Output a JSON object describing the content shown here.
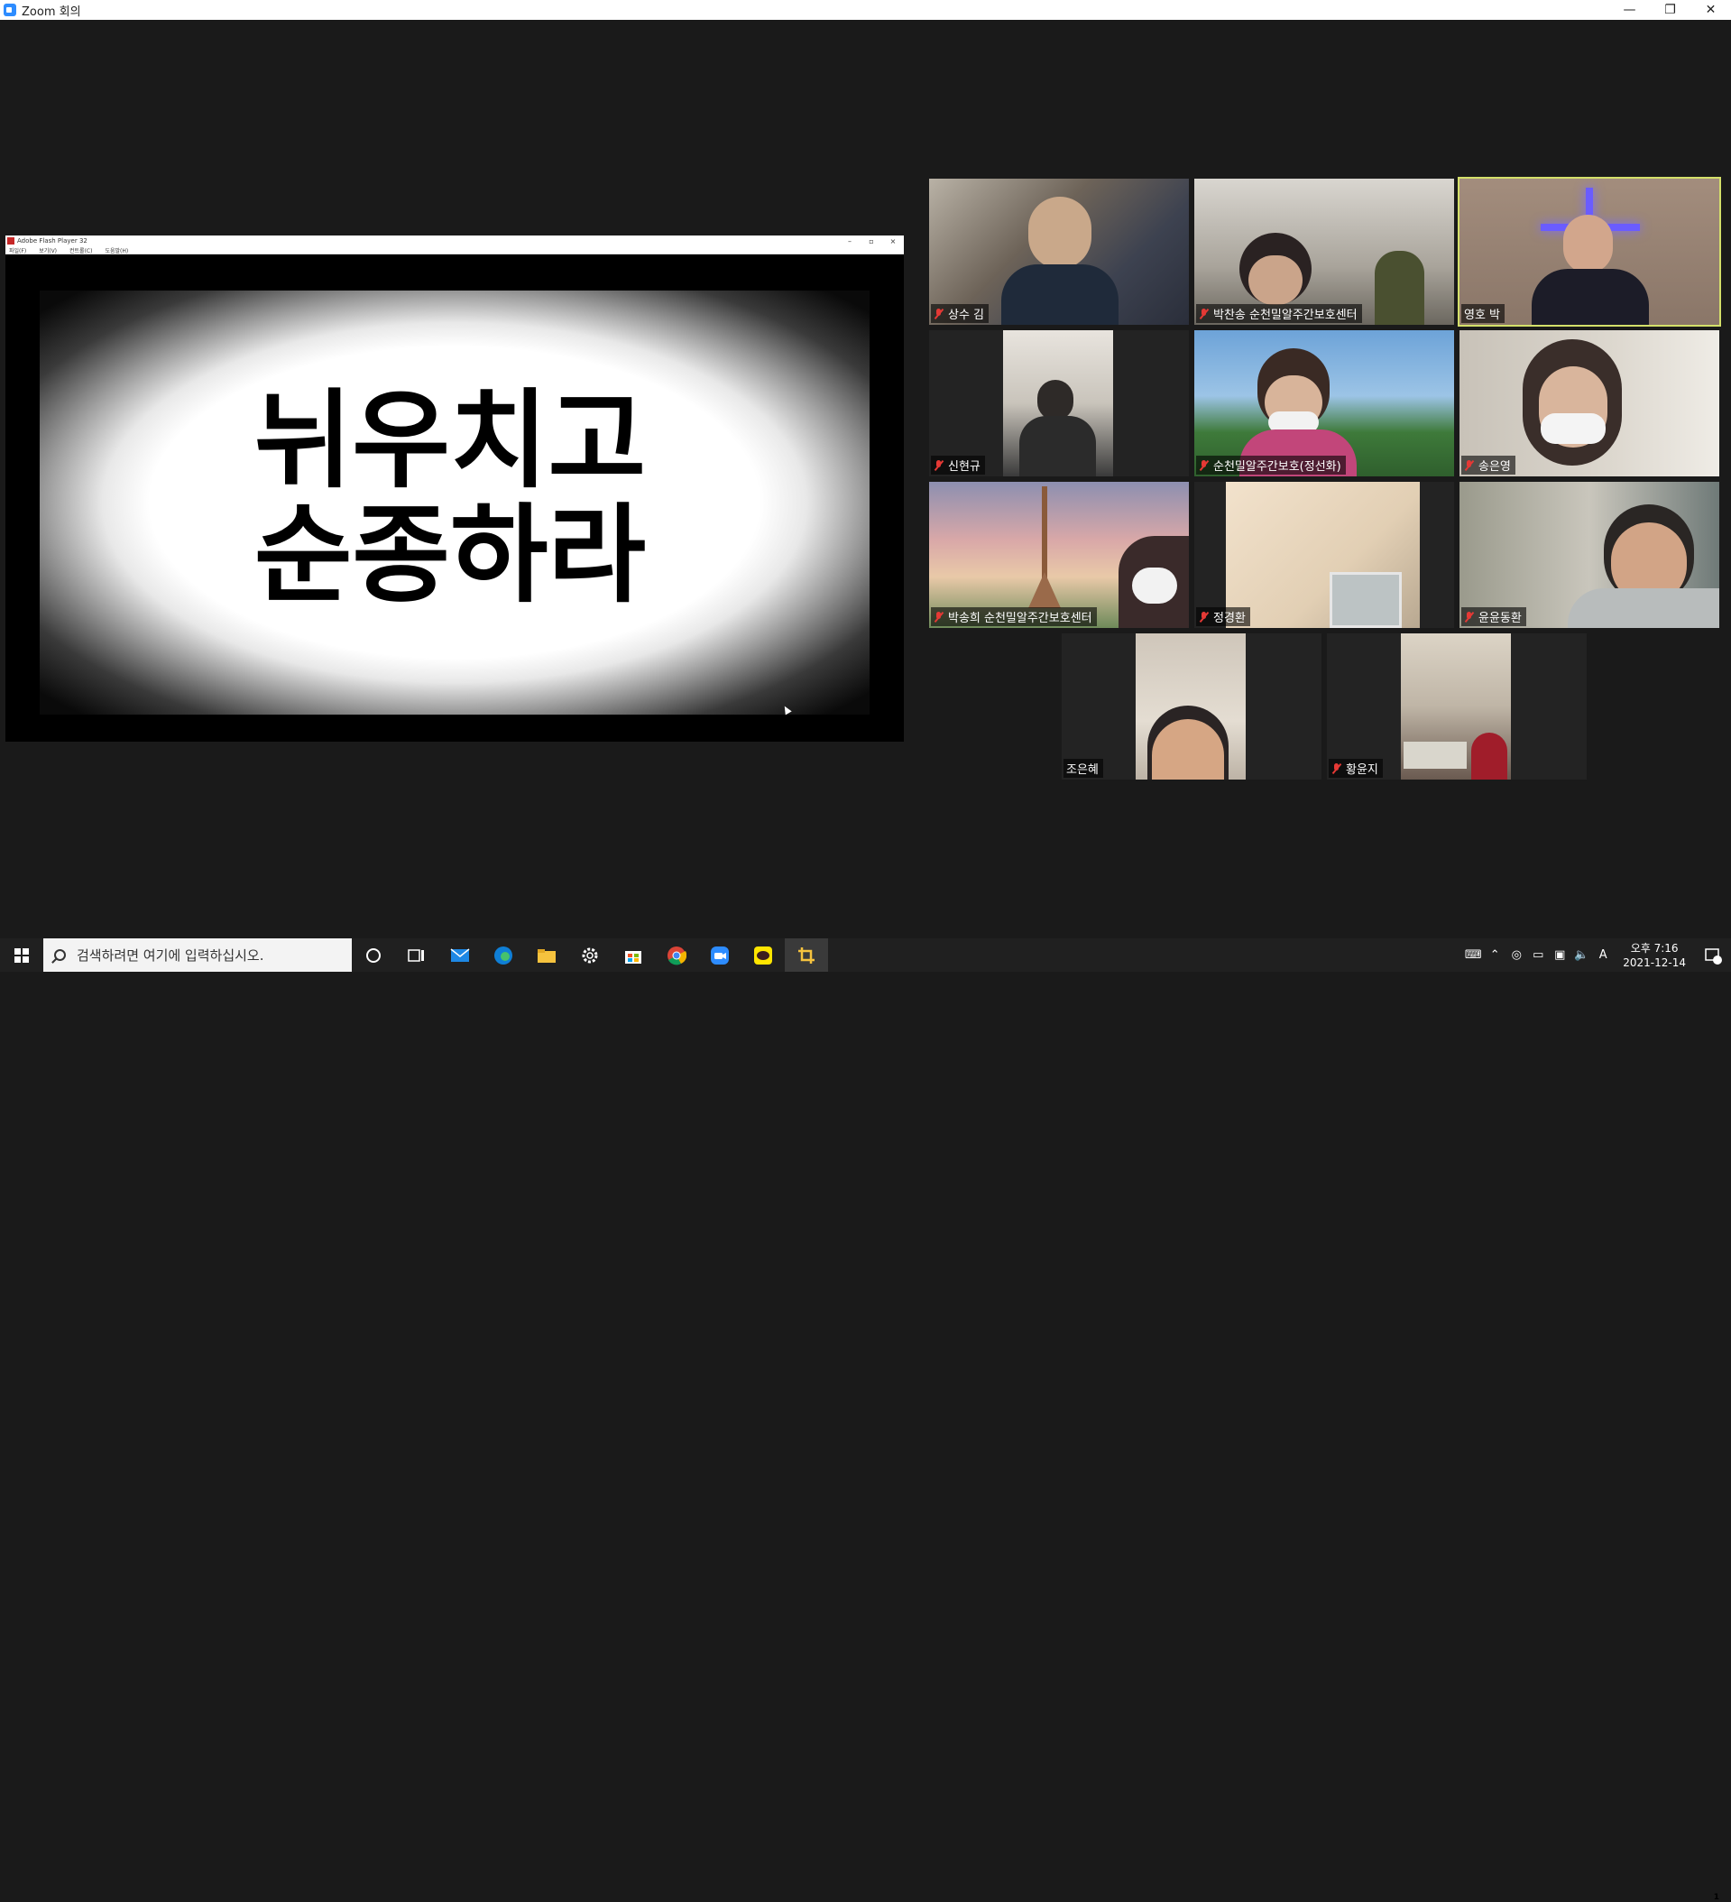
{
  "window": {
    "title": "Zoom 회의",
    "minimize": "—",
    "restore": "❐",
    "close": "✕"
  },
  "share": {
    "window_title": "Adobe Flash Player 32",
    "menu": [
      "파일(F)",
      "보기(V)",
      "컨트롤(C)",
      "도움말(H)"
    ],
    "slide_lines": [
      "뉘우치고",
      "순종하라"
    ]
  },
  "participants": [
    {
      "name": "상수 김",
      "muted": true
    },
    {
      "name": "박찬송 순천밀알주간보호센터",
      "muted": true
    },
    {
      "name": "영호 박",
      "muted": false,
      "active": true
    },
    {
      "name": "신현규",
      "muted": true
    },
    {
      "name": "순천밀알주간보호(정선화)",
      "muted": true
    },
    {
      "name": "송은영",
      "muted": true
    },
    {
      "name": "박송희 순천밀알주간보호센터",
      "muted": true
    },
    {
      "name": "정경환",
      "muted": true
    },
    {
      "name": "윤윤동환",
      "muted": true
    },
    {
      "name": "조은혜",
      "muted": false
    },
    {
      "name": "황윤지",
      "muted": true
    }
  ],
  "taskbar": {
    "search_placeholder": "검색하려면 여기에 입력하십시오.",
    "clock_time": "오후 7:16",
    "clock_date": "2021-12-14",
    "ime": "A",
    "notifications": "1"
  },
  "colors": {
    "active_speaker": "#d4e06a",
    "mute": "#e53935",
    "zoom_blue": "#2d8cff"
  }
}
